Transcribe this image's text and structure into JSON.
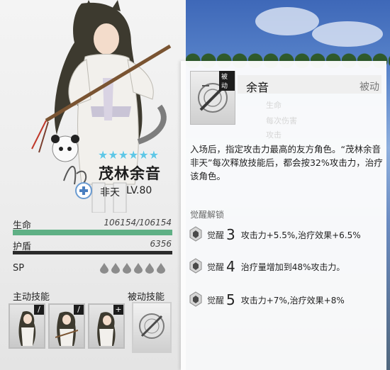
{
  "character": {
    "name": "茂林余音",
    "rank": "非天",
    "level": "LV.80",
    "stars": 6
  },
  "stats": {
    "hp": {
      "label": "生命",
      "value": "106154/106154",
      "fraction": 1.0
    },
    "shield": {
      "label": "护盾",
      "value": "6356",
      "fraction": 0.0
    },
    "sp": {
      "label": "SP",
      "drops": 6
    }
  },
  "skills": {
    "active_label": "主动技能",
    "passive_label": "被动技能",
    "active_badges": [
      "/",
      "/",
      "+"
    ]
  },
  "popup": {
    "tag": "被动",
    "title": "余音",
    "type": "被动",
    "ghost_1": "生命",
    "ghost_2": "每次伤害",
    "ghost_3": "攻击",
    "description": "入场后，指定攻击力最高的友方角色。“茂林余音　非天”每次释放技能后，都会按32%攻击力，治疗该角色。",
    "awakening_header": "觉醒解锁",
    "awakenings": [
      {
        "label": "觉醒",
        "level": "3",
        "text": "攻击力+5.5%,治疗效果+6.5%"
      },
      {
        "label": "觉醒",
        "level": "4",
        "text": "治疗量增加到48%攻击力。"
      },
      {
        "label": "觉醒",
        "level": "5",
        "text": "攻击力+7%,治疗效果+8%"
      }
    ]
  },
  "colors": {
    "hp_bar": "#5fb085",
    "star": "#5fc7e6",
    "accent_dark": "#1d1d1d"
  }
}
